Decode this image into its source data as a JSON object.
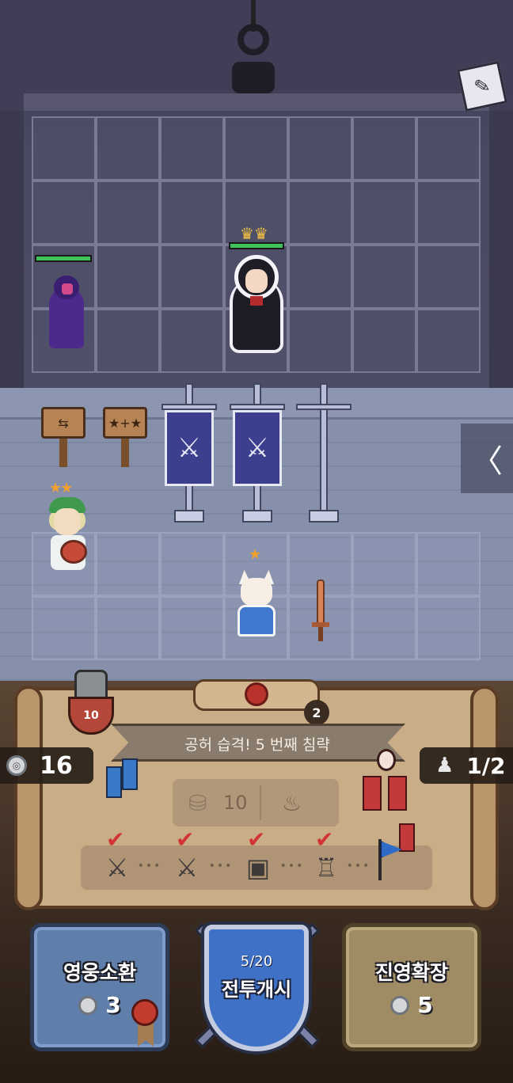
{
  "stage": {
    "title": "공허 습격! 5 번째 침략",
    "wave_badge": "2",
    "level_badge": "10"
  },
  "resources": {
    "coins": "16",
    "units": "1/2"
  },
  "reward": {
    "coins_value": "10"
  },
  "progress": {
    "steps": [
      {
        "icon": "crossed-swords-icon",
        "done": true
      },
      {
        "icon": "crossed-swords-icon",
        "done": true
      },
      {
        "icon": "treasure-chest-icon",
        "done": true
      },
      {
        "icon": "toilet-icon",
        "done": true
      },
      {
        "icon": "goal-flag-icon",
        "done": false
      }
    ]
  },
  "buttons": {
    "summon": {
      "label": "영웅소환",
      "cost": "3"
    },
    "battle": {
      "count": "5/20",
      "label": "전투개시"
    },
    "expand": {
      "label": "진영확장",
      "cost": "5"
    }
  },
  "heroes": {
    "witch_stars": "★★",
    "bard_stars": "★★",
    "catgirl_stars": "★"
  },
  "signs": {
    "swap": "⇆",
    "stars": "★+★"
  },
  "side_tab": "〈",
  "colors": {
    "hp_green": "#3ec45a",
    "star_orange": "#f0a030",
    "shield_blue": "#3f71c6"
  }
}
